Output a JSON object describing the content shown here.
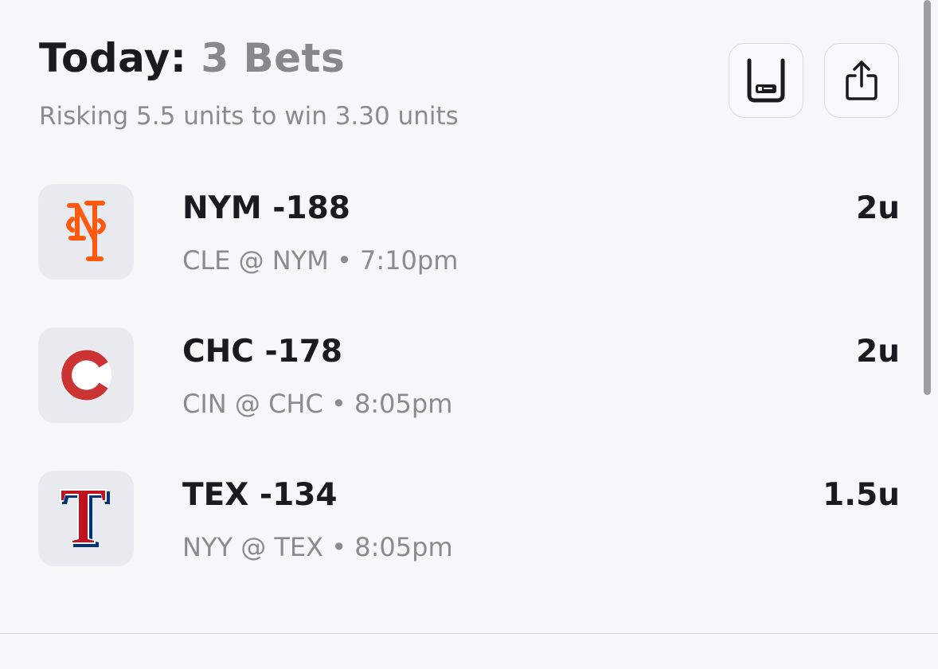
{
  "header": {
    "title_prefix": "Today:",
    "title_count": "3 Bets",
    "subtitle": "Risking 5.5 units to win 3.30 units"
  },
  "actions": {
    "ticket_icon": "bet-slip-icon",
    "share_icon": "share-icon"
  },
  "bets": [
    {
      "team_logo": "mets-logo",
      "line": "NYM -188",
      "meta": "CLE @ NYM • 7:10pm",
      "units": "2u",
      "logo_text": "NY"
    },
    {
      "team_logo": "cubs-logo",
      "line": "CHC -178",
      "meta": "CIN @ CHC • 8:05pm",
      "units": "2u",
      "logo_text": "C"
    },
    {
      "team_logo": "rangers-logo",
      "line": "TEX -134",
      "meta": "NYY @ TEX • 8:05pm",
      "units": "1.5u",
      "logo_text": "T"
    }
  ],
  "colors": {
    "background": "#f6f7fb",
    "primary_text": "#1a1b21",
    "secondary_text": "#8a8a8f",
    "mets_orange": "#ff5910",
    "cubs_red": "#cc3433",
    "rangers_red": "#c0111f",
    "rangers_blue": "#003278"
  }
}
